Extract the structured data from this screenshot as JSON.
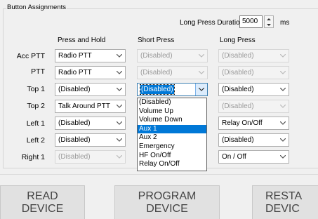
{
  "group": {
    "title": "Button Assignments"
  },
  "long_press_duration": {
    "label": "Long Press Duration",
    "value": "5000",
    "unit": "ms"
  },
  "columns": {
    "press_and_hold": "Press and Hold",
    "short_press": "Short Press",
    "long_press": "Long Press"
  },
  "rows": [
    {
      "label": "Acc PTT",
      "press_and_hold": "Radio PTT",
      "short_press": "(Disabled)",
      "long_press": "(Disabled)"
    },
    {
      "label": "PTT",
      "press_and_hold": "Radio PTT",
      "short_press": "(Disabled)",
      "long_press": "(Disabled)"
    },
    {
      "label": "Top 1",
      "press_and_hold": "(Disabled)",
      "short_press": "(Disabled)",
      "long_press": "(Disabled)"
    },
    {
      "label": "Top 2",
      "press_and_hold": "Talk Around PTT",
      "short_press": "",
      "long_press": "(Disabled)"
    },
    {
      "label": "Left 1",
      "press_and_hold": "(Disabled)",
      "short_press": "",
      "long_press": "Relay On/Off"
    },
    {
      "label": "Left 2",
      "press_and_hold": "(Disabled)",
      "short_press": "",
      "long_press": "(Disabled)"
    },
    {
      "label": "Right 1",
      "press_and_hold": "(Disabled)",
      "short_press": "",
      "long_press": "On / Off"
    }
  ],
  "dropdown": {
    "options": [
      "(Disabled)",
      "Volume Up",
      "Volume Down",
      "Aux 1",
      "Aux 2",
      "Emergency",
      "HF On/Off",
      "Relay On/Off"
    ],
    "selected_index": 3
  },
  "buttons": {
    "read": {
      "line1": "READ",
      "line2": "DEVICE"
    },
    "program": {
      "line1": "PROGRAM",
      "line2": "DEVICE"
    },
    "restore": {
      "line1": "RESTA",
      "line2": "DEVIC"
    }
  },
  "colors": {
    "highlight": "#0078d7",
    "button_face": "#e1e1e1",
    "window": "#f0f0f0"
  }
}
